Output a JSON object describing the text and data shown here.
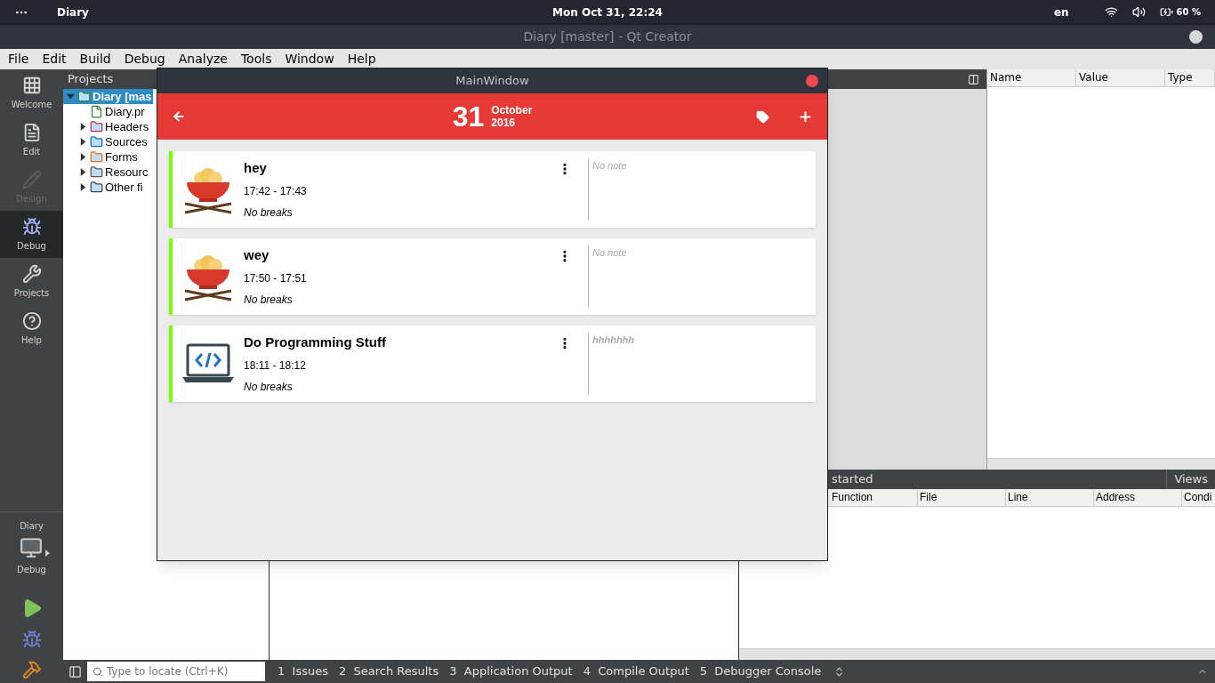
{
  "system_bar": {
    "app": "Diary",
    "clock": "Mon Oct 31, 22:24",
    "language": "en",
    "battery": "60 %"
  },
  "window": {
    "title": "Diary [master] - Qt Creator"
  },
  "menu": [
    "File",
    "Edit",
    "Build",
    "Debug",
    "Analyze",
    "Tools",
    "Window",
    "Help"
  ],
  "modes": [
    {
      "label": "Welcome",
      "kind": "grid",
      "selected": false,
      "disabled": false
    },
    {
      "label": "Edit",
      "kind": "document",
      "selected": false,
      "disabled": false
    },
    {
      "label": "Design",
      "kind": "pencil",
      "selected": false,
      "disabled": true
    },
    {
      "label": "Debug",
      "kind": "bug",
      "selected": true,
      "disabled": false
    },
    {
      "label": "Projects",
      "kind": "wrench",
      "selected": false,
      "disabled": false
    },
    {
      "label": "Help",
      "kind": "help",
      "selected": false,
      "disabled": false
    }
  ],
  "target": {
    "project": "Diary",
    "build": "Debug"
  },
  "projects": {
    "title": "Projects",
    "tree": [
      {
        "label": "Diary [mas",
        "kind": "project",
        "expanded": true,
        "selected": true,
        "children": [
          {
            "label": "Diary.pr",
            "kind": "pro-file",
            "selected": false
          },
          {
            "label": "Headers",
            "kind": "headers",
            "expanded": false,
            "selected": false
          },
          {
            "label": "Sources",
            "kind": "sources",
            "expanded": false,
            "selected": false
          },
          {
            "label": "Forms",
            "kind": "forms",
            "expanded": false,
            "selected": false
          },
          {
            "label": "Resourc",
            "kind": "resources",
            "expanded": false,
            "selected": false
          },
          {
            "label": "Other fi",
            "kind": "other",
            "expanded": false,
            "selected": false
          }
        ]
      }
    ]
  },
  "locals": {
    "columns": [
      "Name",
      "Value",
      "Type"
    ]
  },
  "breakpoints": {
    "title": "started",
    "views": "Views",
    "columns": [
      "Function",
      "File",
      "Line",
      "Address",
      "Condi"
    ]
  },
  "bottom_bar": {
    "search": {
      "placeholder": "Type to locate (Ctrl+K)"
    },
    "panes": [
      {
        "number": "1",
        "label": "Issues"
      },
      {
        "number": "2",
        "label": "Search Results"
      },
      {
        "number": "3",
        "label": "Application Output"
      },
      {
        "number": "4",
        "label": "Compile Output"
      },
      {
        "number": "5",
        "label": "Debugger Console"
      }
    ]
  },
  "app_window": {
    "title": "MainWindow",
    "day": "31",
    "month": "October",
    "year": "2016",
    "entries": [
      {
        "title": "hey",
        "time": "17:42 - 17:43",
        "breaks": "No breaks",
        "kind": "food",
        "note": {
          "placeholder": "No note"
        }
      },
      {
        "title": "wey",
        "time": "17:50 - 17:51",
        "breaks": "No breaks",
        "kind": "food",
        "note": {
          "placeholder": "No note"
        }
      },
      {
        "title": "Do Programming Stuff",
        "time": "18:11 - 18:12",
        "breaks": "No breaks",
        "kind": "code",
        "note": {
          "value": "hhhhhhh"
        }
      }
    ]
  }
}
